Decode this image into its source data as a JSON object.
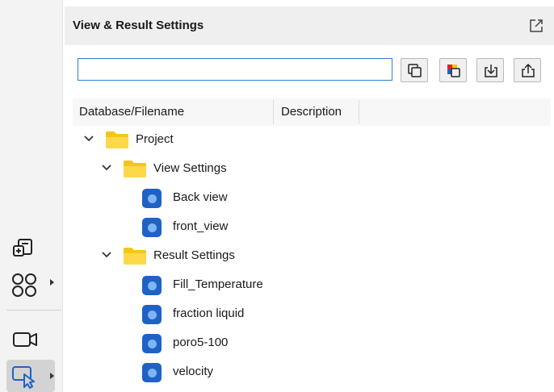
{
  "panel": {
    "title": "View & Result Settings",
    "search_value": ""
  },
  "columns": [
    "Database/Filename",
    "Description"
  ],
  "tree": {
    "root": "Project",
    "groups": [
      {
        "label": "View Settings",
        "items": [
          "Back view",
          "front_view"
        ]
      },
      {
        "label": "Result Settings",
        "items": [
          "Fill_Temperature",
          "fraction liquid",
          "poro5-100",
          "velocity"
        ]
      }
    ]
  },
  "colors": {
    "accent": "#2f7fd6",
    "folder": "#f5c518",
    "item": "#1f62c4"
  },
  "icons": {
    "rail": [
      "add-database-icon",
      "grid-apps-icon",
      "camera-icon",
      "select-pointer-icon"
    ],
    "toolbar": [
      "copy-view-icon",
      "color-view-icon",
      "import-icon",
      "export-icon"
    ],
    "header": "popout-icon"
  }
}
